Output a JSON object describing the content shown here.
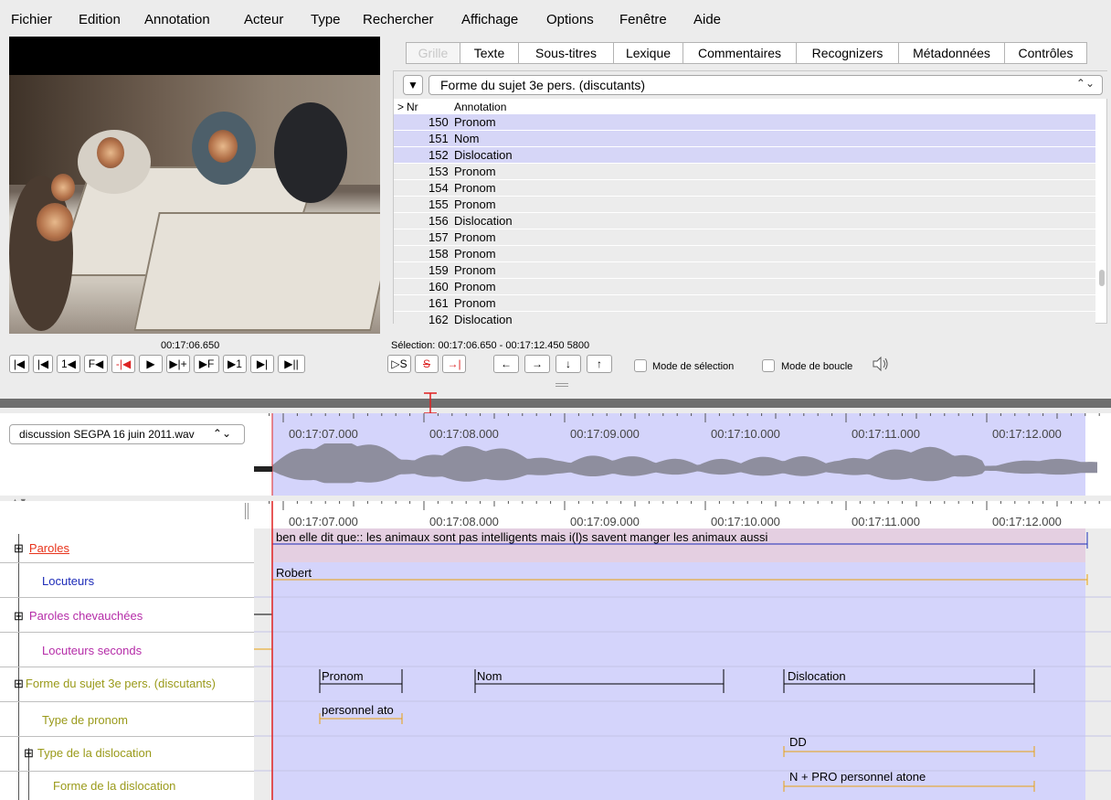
{
  "menubar": [
    "Fichier",
    "Edition",
    "Annotation",
    "Acteur",
    "Type",
    "Rechercher",
    "Affichage",
    "Options",
    "Fenêtre",
    "Aide"
  ],
  "tabs": [
    "Grille",
    "Texte",
    "Sous-titres",
    "Lexique",
    "Commentaires",
    "Recognizers",
    "Métadonnées",
    "Contrôles"
  ],
  "grid": {
    "selected_tier": "Forme du sujet 3e pers. (discutants)",
    "col_marker": ">",
    "col_nr": "Nr",
    "col_annotation": "Annotation",
    "rows": [
      {
        "nr": "150",
        "annotation": "Pronom"
      },
      {
        "nr": "151",
        "annotation": "Nom"
      },
      {
        "nr": "152",
        "annotation": "Dislocation"
      },
      {
        "nr": "153",
        "annotation": "Pronom"
      },
      {
        "nr": "154",
        "annotation": "Pronom"
      },
      {
        "nr": "155",
        "annotation": "Pronom"
      },
      {
        "nr": "156",
        "annotation": "Dislocation"
      },
      {
        "nr": "157",
        "annotation": "Pronom"
      },
      {
        "nr": "158",
        "annotation": "Pronom"
      },
      {
        "nr": "159",
        "annotation": "Pronom"
      },
      {
        "nr": "160",
        "annotation": "Pronom"
      },
      {
        "nr": "161",
        "annotation": "Pronom"
      },
      {
        "nr": "162",
        "annotation": "Dislocation"
      }
    ]
  },
  "player": {
    "current_time": "00:17:06.650",
    "selection": "Sélection: 00:17:06.650 - 00:17:12.450  5800",
    "buttons_left": [
      "|◀",
      "|◀",
      "1◀",
      "F◀",
      "-|◀",
      "▶",
      "▶|+",
      "▶F",
      "▶1",
      "▶|",
      "▶||"
    ],
    "buttons_mid": [
      "▷S",
      "S",
      "→|"
    ],
    "buttons_nav": [
      "←",
      "→",
      "↓",
      "↑"
    ],
    "mode_selection": "Mode de sélection",
    "mode_boucle": "Mode de boucle"
  },
  "waveform": {
    "file": "discussion SEGPA 16 juin 2011.wav",
    "ticks": [
      "00:17:07.000",
      "00:17:08.000",
      "00:17:09.000",
      "00:17:10.000",
      "00:17:11.000",
      "00:17:12.000"
    ]
  },
  "timeline": {
    "ticks": [
      "00:17:07.000",
      "00:17:08.000",
      "00:17:09.000",
      "00:17:10.000",
      "00:17:11.000",
      "00:17:12.000"
    ],
    "tiers": [
      {
        "name": "Paroles",
        "color": "#e8341c"
      },
      {
        "name": "Locuteurs",
        "color": "#1d2bb8"
      },
      {
        "name": "Paroles chevauchées",
        "color": "#b52ca8"
      },
      {
        "name": "Locuteurs seconds",
        "color": "#b52ca8"
      },
      {
        "name": "Forme du sujet 3e pers. (discutants)",
        "color": "#9a9a1a"
      },
      {
        "name": "Type de pronom",
        "color": "#9a9a1a"
      },
      {
        "name": "Type de la dislocation",
        "color": "#9a9a1a"
      },
      {
        "name": "Forme de la dislocation",
        "color": "#9a9a1a"
      }
    ],
    "annotations": {
      "paroles": "ben elle dit que:: les animaux sont pas intelligents mais i(l)s savent manger les animaux aussi",
      "locuteur": "Robert",
      "forme1": "Pronom",
      "forme2": "Nom",
      "forme3": "Dislocation",
      "type_pronom": "personnel ato",
      "type_dislocation": "DD",
      "forme_dislocation": "N + PRO personnel atone"
    }
  },
  "colors": {
    "selection": "#d4d4fb",
    "row_sel": "#d6d6f7",
    "row_alt": "#ececec",
    "crosshair": "#e02020"
  }
}
